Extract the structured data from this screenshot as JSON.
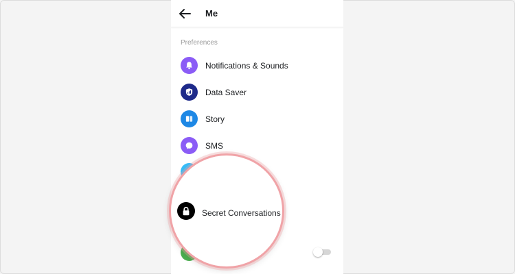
{
  "header": {
    "title": "Me",
    "back_icon": "arrow-left-icon"
  },
  "preferences": {
    "section_label": "Preferences",
    "items": [
      {
        "label": "Notifications & Sounds",
        "icon": "bell-icon",
        "color": "#8b5cf6"
      },
      {
        "label": "Data Saver",
        "icon": "signal-shield-icon",
        "color": "#1e2a8a"
      },
      {
        "label": "Story",
        "icon": "story-icon",
        "color": "#1e88e5"
      },
      {
        "label": "SMS",
        "icon": "chat-bubble-icon",
        "color": "#8b5cf6"
      }
    ],
    "partial_icon_colors": [
      "#38bdf8",
      "#4caf50"
    ]
  },
  "highlight": {
    "label": "Secret Conversations",
    "icon": "lock-icon",
    "icon_color": "#000000",
    "ring_color": "#f0a3a7"
  },
  "toggle": {
    "state": "off"
  }
}
